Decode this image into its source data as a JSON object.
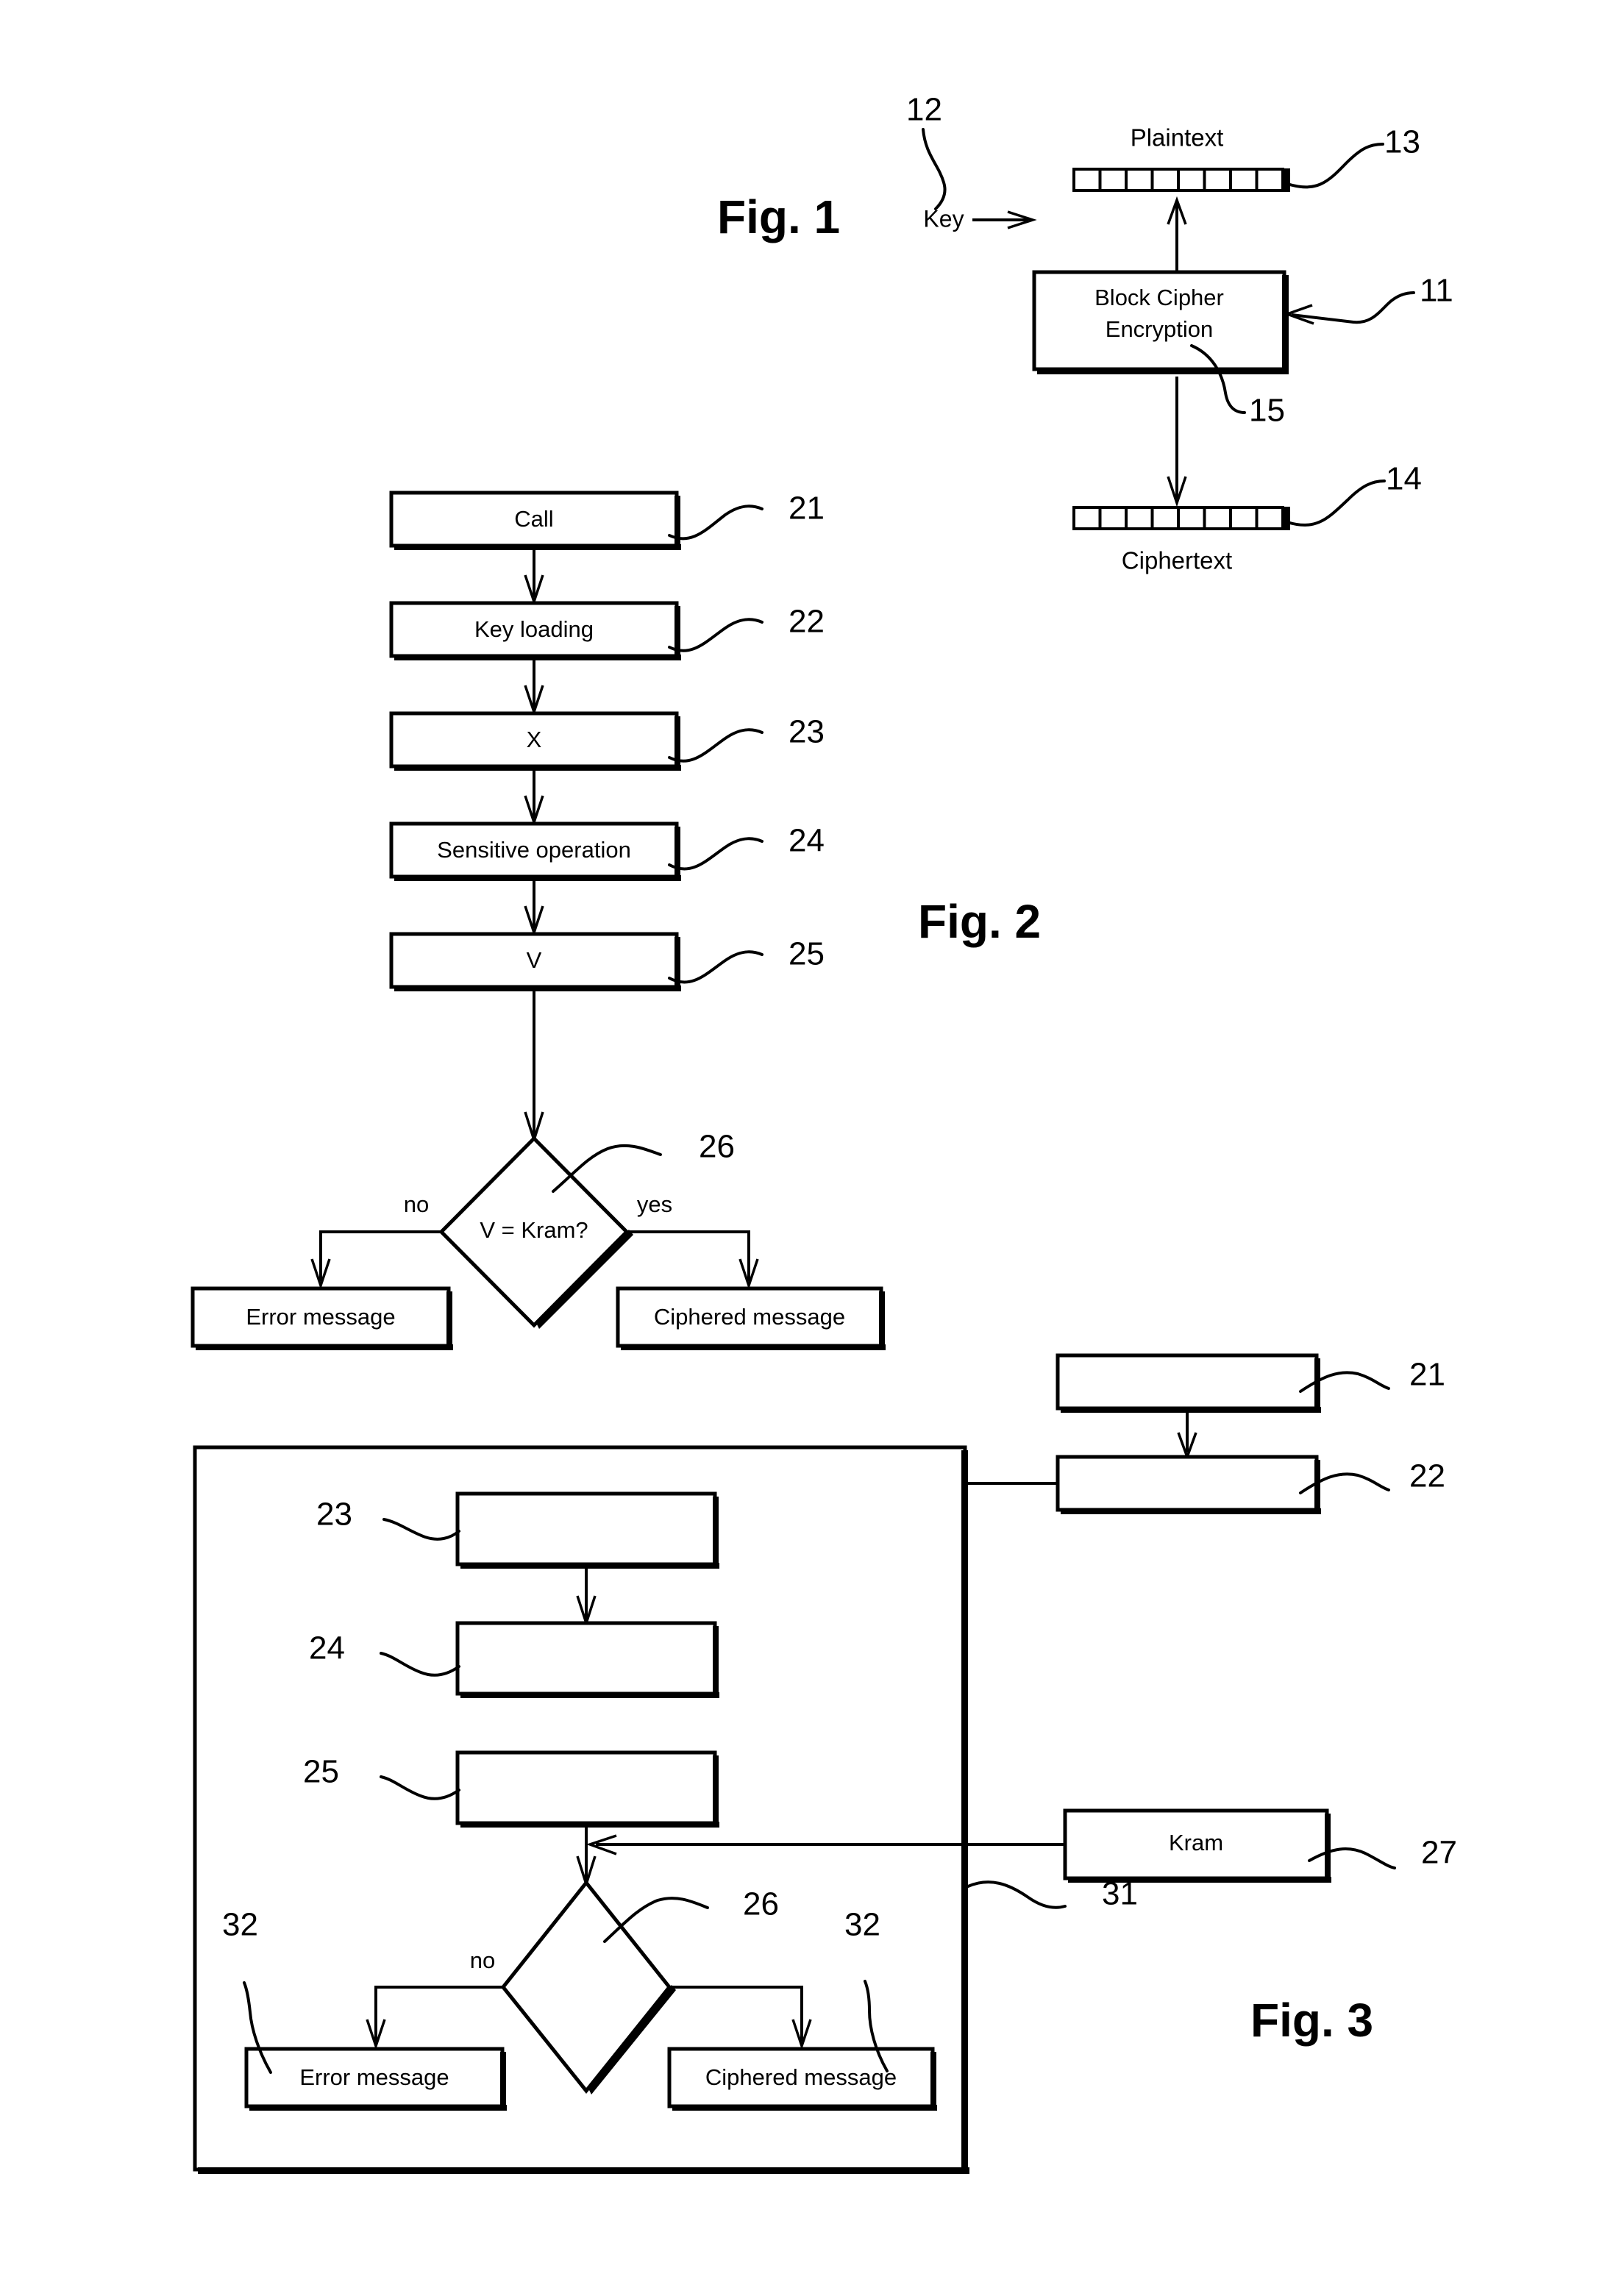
{
  "figures": [
    {
      "id": "fig1",
      "title": "Fig. 1",
      "labels": {
        "plaintext": "Plaintext",
        "ciphertext": "Ciphertext",
        "key": "Key",
        "cipher_block": [
          "Block Cipher",
          "Encryption"
        ]
      },
      "reference_numerals": {
        "key": "12",
        "cipher_block": "11",
        "plaintext_array": "13",
        "ciphertext_array": "14",
        "cipher_block_interior": "15"
      },
      "plaintext_cells": 8,
      "ciphertext_cells": 8
    },
    {
      "id": "fig2",
      "title": "Fig. 2",
      "steps": [
        {
          "ref": "21",
          "label": "Call"
        },
        {
          "ref": "22",
          "label": "Key loading"
        },
        {
          "ref": "23",
          "label": "X"
        },
        {
          "ref": "24",
          "label": "Sensitive operation"
        },
        {
          "ref": "25",
          "label": "V"
        }
      ],
      "decision": {
        "ref": "26",
        "label": "V = Kram?",
        "no": "no",
        "yes": "yes"
      },
      "outcomes": [
        {
          "label": "Error message"
        },
        {
          "label": "Ciphered message"
        }
      ]
    },
    {
      "id": "fig3",
      "title": "Fig. 3",
      "container_ref": "31",
      "steps": [
        {
          "ref": "21",
          "label": ""
        },
        {
          "ref": "22",
          "label": ""
        },
        {
          "ref": "23",
          "label": ""
        },
        {
          "ref": "24",
          "label": ""
        },
        {
          "ref": "25",
          "label": ""
        }
      ],
      "kram": {
        "ref": "27",
        "label": "Kram"
      },
      "decision": {
        "ref": "26",
        "label": "",
        "no": "no"
      },
      "outcomes": [
        {
          "ref": "32",
          "label": "Error message"
        },
        {
          "ref": "32",
          "label": "Ciphered message"
        }
      ]
    }
  ],
  "colors": {
    "ink": "#000000",
    "paper": "#ffffff"
  }
}
